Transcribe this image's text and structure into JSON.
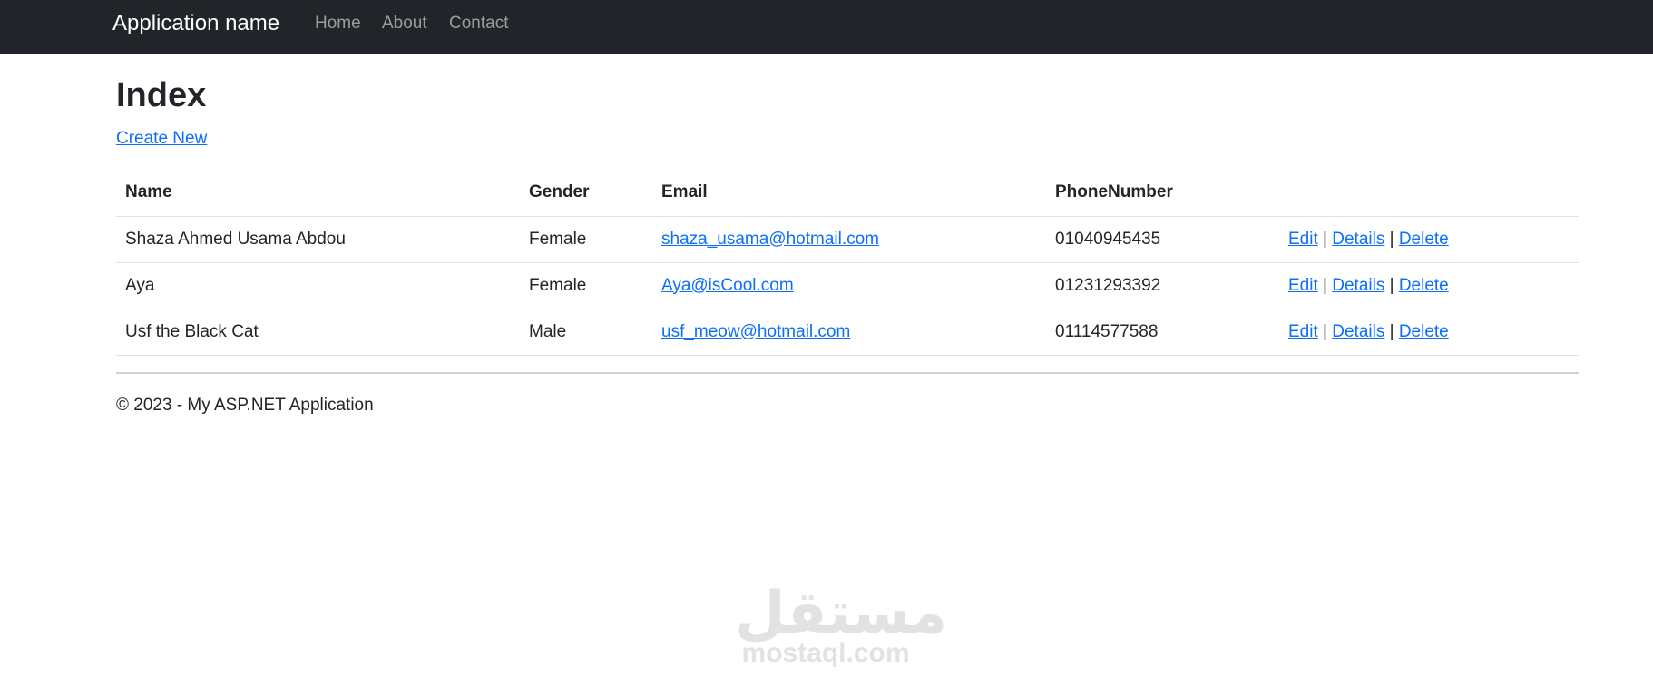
{
  "navbar": {
    "brand": "Application name",
    "links": [
      "Home",
      "About",
      "Contact"
    ]
  },
  "main": {
    "title": "Index",
    "create_label": "Create New",
    "table": {
      "headers": [
        "Name",
        "Gender",
        "Email",
        "PhoneNumber"
      ],
      "rows": [
        {
          "name": "Shaza Ahmed Usama Abdou",
          "gender": "Female",
          "email": "shaza_usama@hotmail.com",
          "phone": "01040945435"
        },
        {
          "name": "Aya",
          "gender": "Female",
          "email": "Aya@isCool.com",
          "phone": "01231293392"
        },
        {
          "name": "Usf the Black Cat",
          "gender": "Male",
          "email": "usf_meow@hotmail.com",
          "phone": "01114577588"
        }
      ],
      "actions": {
        "edit": "Edit",
        "details": "Details",
        "delete": "Delete",
        "separator": "|"
      }
    }
  },
  "footer": {
    "text": "© 2023 - My ASP.NET Application"
  },
  "watermark": {
    "arabic": "مستقل",
    "latin": "mostaql.com"
  },
  "colors": {
    "navbar_bg": "#212529",
    "link": "#0d6efd",
    "text": "#212529"
  }
}
